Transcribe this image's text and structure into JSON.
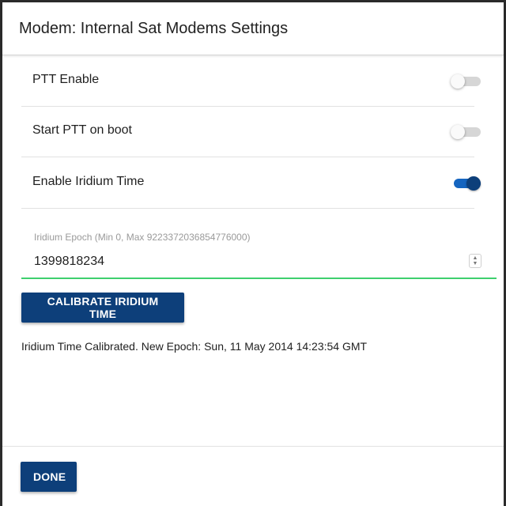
{
  "dialog": {
    "title": "Modem: Internal Sat Modems Settings"
  },
  "settings": {
    "items": [
      {
        "label": "PTT Enable",
        "enabled": false
      },
      {
        "label": "Start PTT on boot",
        "enabled": false
      },
      {
        "label": "Enable Iridium Time",
        "enabled": true
      }
    ]
  },
  "epoch_field": {
    "label": "Iridium Epoch (Min 0, Max 9223372036854776000)",
    "value": "1399818234"
  },
  "calibrate_button": {
    "label": "CALIBRATE IRIDIUM TIME"
  },
  "status": {
    "message": "Iridium Time Calibrated. New Epoch: Sun, 11 May 2014 14:23:54 GMT"
  },
  "footer": {
    "done_label": "DONE"
  },
  "colors": {
    "primary": "#0d3f7a",
    "toggle_on_track": "#1565c0",
    "field_underline": "#3ecf6e"
  }
}
